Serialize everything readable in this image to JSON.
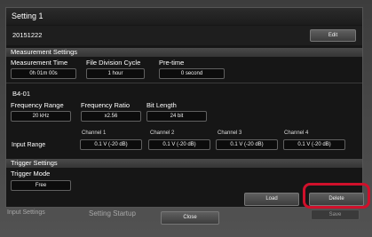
{
  "background_app": {
    "bottom_left_label": "Input Settings",
    "bottom_center_label": "Setting Startup",
    "bottom_right_label": "Save"
  },
  "dialog": {
    "title": "Setting 1",
    "setting_name": "20151222",
    "edit_label": "Edit"
  },
  "measurement": {
    "header": "Measurement Settings",
    "measurement_time_label": "Measurement Time",
    "measurement_time_value": "0h 01m 00s",
    "file_division_label": "File Division Cycle",
    "file_division_value": "1 hour",
    "pretime_label": "Pre-time",
    "pretime_value": "0 second"
  },
  "module": {
    "name": "B4-01",
    "frequency_range_label": "Frequency Range",
    "frequency_range_value": "20 kHz",
    "frequency_ratio_label": "Frequency Ratio",
    "frequency_ratio_value": "x2.56",
    "bit_length_label": "Bit Length",
    "bit_length_value": "24 bit",
    "input_range_label": "Input Range",
    "channels": [
      {
        "name": "Channel 1",
        "value": "0.1 V (-20 dB)"
      },
      {
        "name": "Channel 2",
        "value": "0.1 V (-20 dB)"
      },
      {
        "name": "Channel 3",
        "value": "0.1 V (-20 dB)"
      },
      {
        "name": "Channel 4",
        "value": "0.1 V (-20 dB)"
      }
    ]
  },
  "trigger": {
    "header": "Trigger Settings",
    "mode_label": "Trigger Mode",
    "mode_value": "Free"
  },
  "actions": {
    "load_label": "Load",
    "delete_label": "Delete",
    "close_label": "Close"
  },
  "colors": {
    "highlight": "#d0102b",
    "dialog_background": "#161616",
    "section_header": "#404040"
  }
}
